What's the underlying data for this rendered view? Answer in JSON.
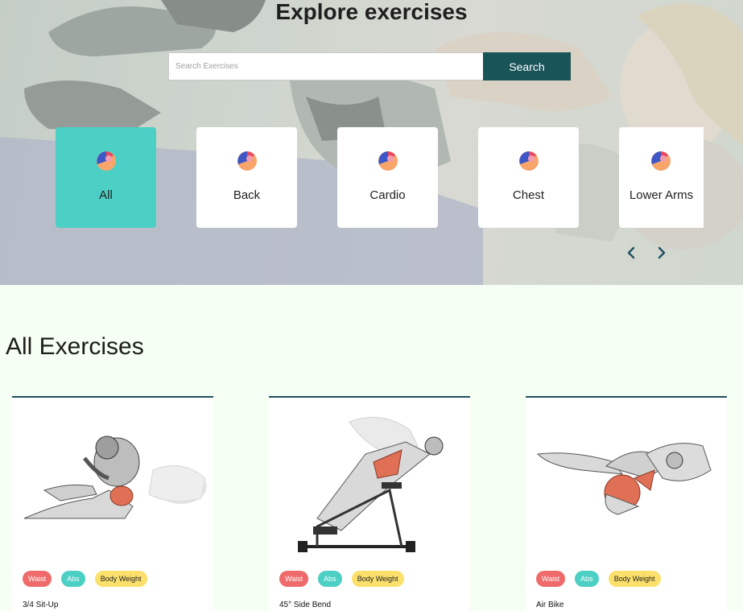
{
  "hero": {
    "title": "Explore exercises",
    "search_placeholder": "Search Exercises",
    "search_button": "Search"
  },
  "categories": [
    {
      "label": "All",
      "active": true
    },
    {
      "label": "Back",
      "active": false
    },
    {
      "label": "Cardio",
      "active": false
    },
    {
      "label": "Chest",
      "active": false
    },
    {
      "label": "Lower Arms",
      "active": false
    }
  ],
  "carousel": {
    "prev_icon": "chevron-left-icon",
    "next_icon": "chevron-right-icon"
  },
  "section": {
    "title": "All Exercises"
  },
  "exercises": [
    {
      "name": "3/4 Sit-Up",
      "tags": [
        "Waist",
        "Abs",
        "Body Weight"
      ]
    },
    {
      "name": "45° Side Bend",
      "tags": [
        "Waist",
        "Abs",
        "Body Weight"
      ]
    },
    {
      "name": "Air Bike",
      "tags": [
        "Waist",
        "Abs",
        "Body Weight"
      ]
    }
  ],
  "colors": {
    "accent_teal": "#4ccfc4",
    "button_dark": "#195459",
    "tag_red": "#ef6a6a",
    "tag_yellow": "#fbe06b",
    "page_bg": "#f6fff3"
  }
}
